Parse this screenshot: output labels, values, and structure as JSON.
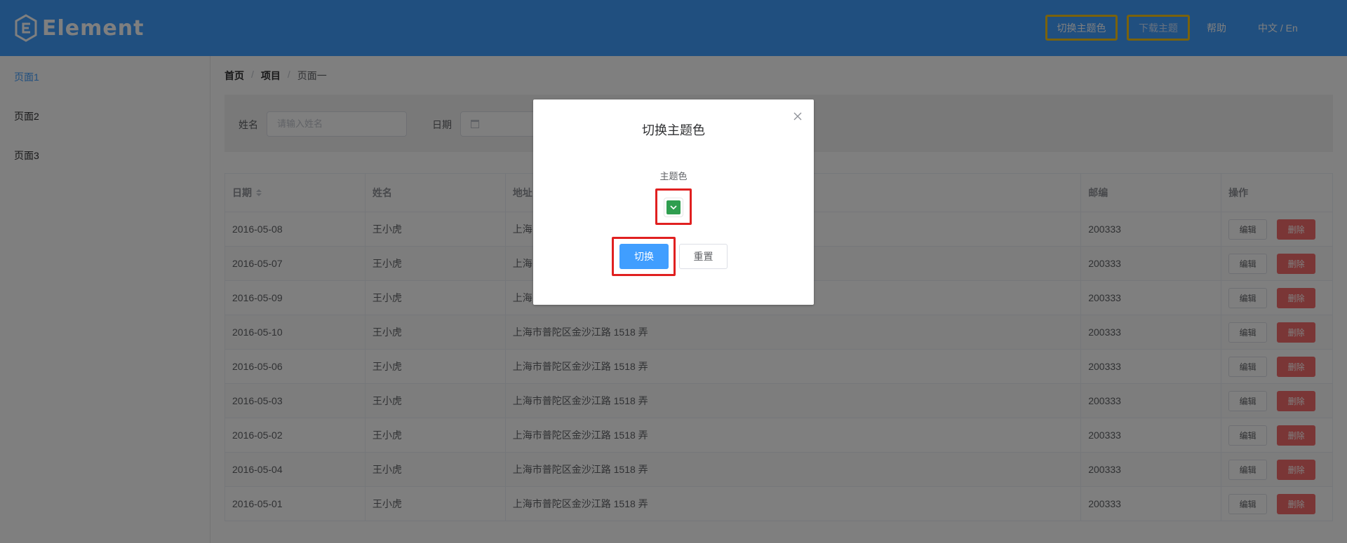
{
  "header": {
    "logo_text": "Element",
    "switch_theme_label": "切换主题色",
    "download_theme_label": "下载主题",
    "help_label": "帮助",
    "lang_label": "中文 / En"
  },
  "sidebar": {
    "items": [
      {
        "label": "页面1",
        "active": true
      },
      {
        "label": "页面2",
        "active": false
      },
      {
        "label": "页面3",
        "active": false
      }
    ]
  },
  "breadcrumb": [
    "首页",
    "项目",
    "页面一"
  ],
  "filter": {
    "name_label": "姓名",
    "name_placeholder": "请输入姓名",
    "date_label": "日期"
  },
  "table": {
    "columns": [
      "日期",
      "姓名",
      "地址",
      "邮编",
      "操作"
    ],
    "rows": [
      {
        "date": "2016-05-08",
        "name": "王小虎",
        "address": "上海",
        "zip": "200333"
      },
      {
        "date": "2016-05-07",
        "name": "王小虎",
        "address": "上海",
        "zip": "200333"
      },
      {
        "date": "2016-05-09",
        "name": "王小虎",
        "address": "上海",
        "zip": "200333"
      },
      {
        "date": "2016-05-10",
        "name": "王小虎",
        "address": "上海市普陀区金沙江路 1518 弄",
        "zip": "200333"
      },
      {
        "date": "2016-05-06",
        "name": "王小虎",
        "address": "上海市普陀区金沙江路 1518 弄",
        "zip": "200333"
      },
      {
        "date": "2016-05-03",
        "name": "王小虎",
        "address": "上海市普陀区金沙江路 1518 弄",
        "zip": "200333"
      },
      {
        "date": "2016-05-02",
        "name": "王小虎",
        "address": "上海市普陀区金沙江路 1518 弄",
        "zip": "200333"
      },
      {
        "date": "2016-05-04",
        "name": "王小虎",
        "address": "上海市普陀区金沙江路 1518 弄",
        "zip": "200333"
      },
      {
        "date": "2016-05-01",
        "name": "王小虎",
        "address": "上海市普陀区金沙江路 1518 弄",
        "zip": "200333"
      }
    ],
    "edit_label": "编辑",
    "delete_label": "删除"
  },
  "dialog": {
    "title": "切换主题色",
    "field_label": "主题色",
    "selected_color": "#2f9e4f",
    "confirm_label": "切换",
    "reset_label": "重置"
  },
  "colors": {
    "primary": "#409eff",
    "danger": "#f56c6c",
    "highlight_yellow": "#f5c518",
    "highlight_red": "#e02020"
  }
}
